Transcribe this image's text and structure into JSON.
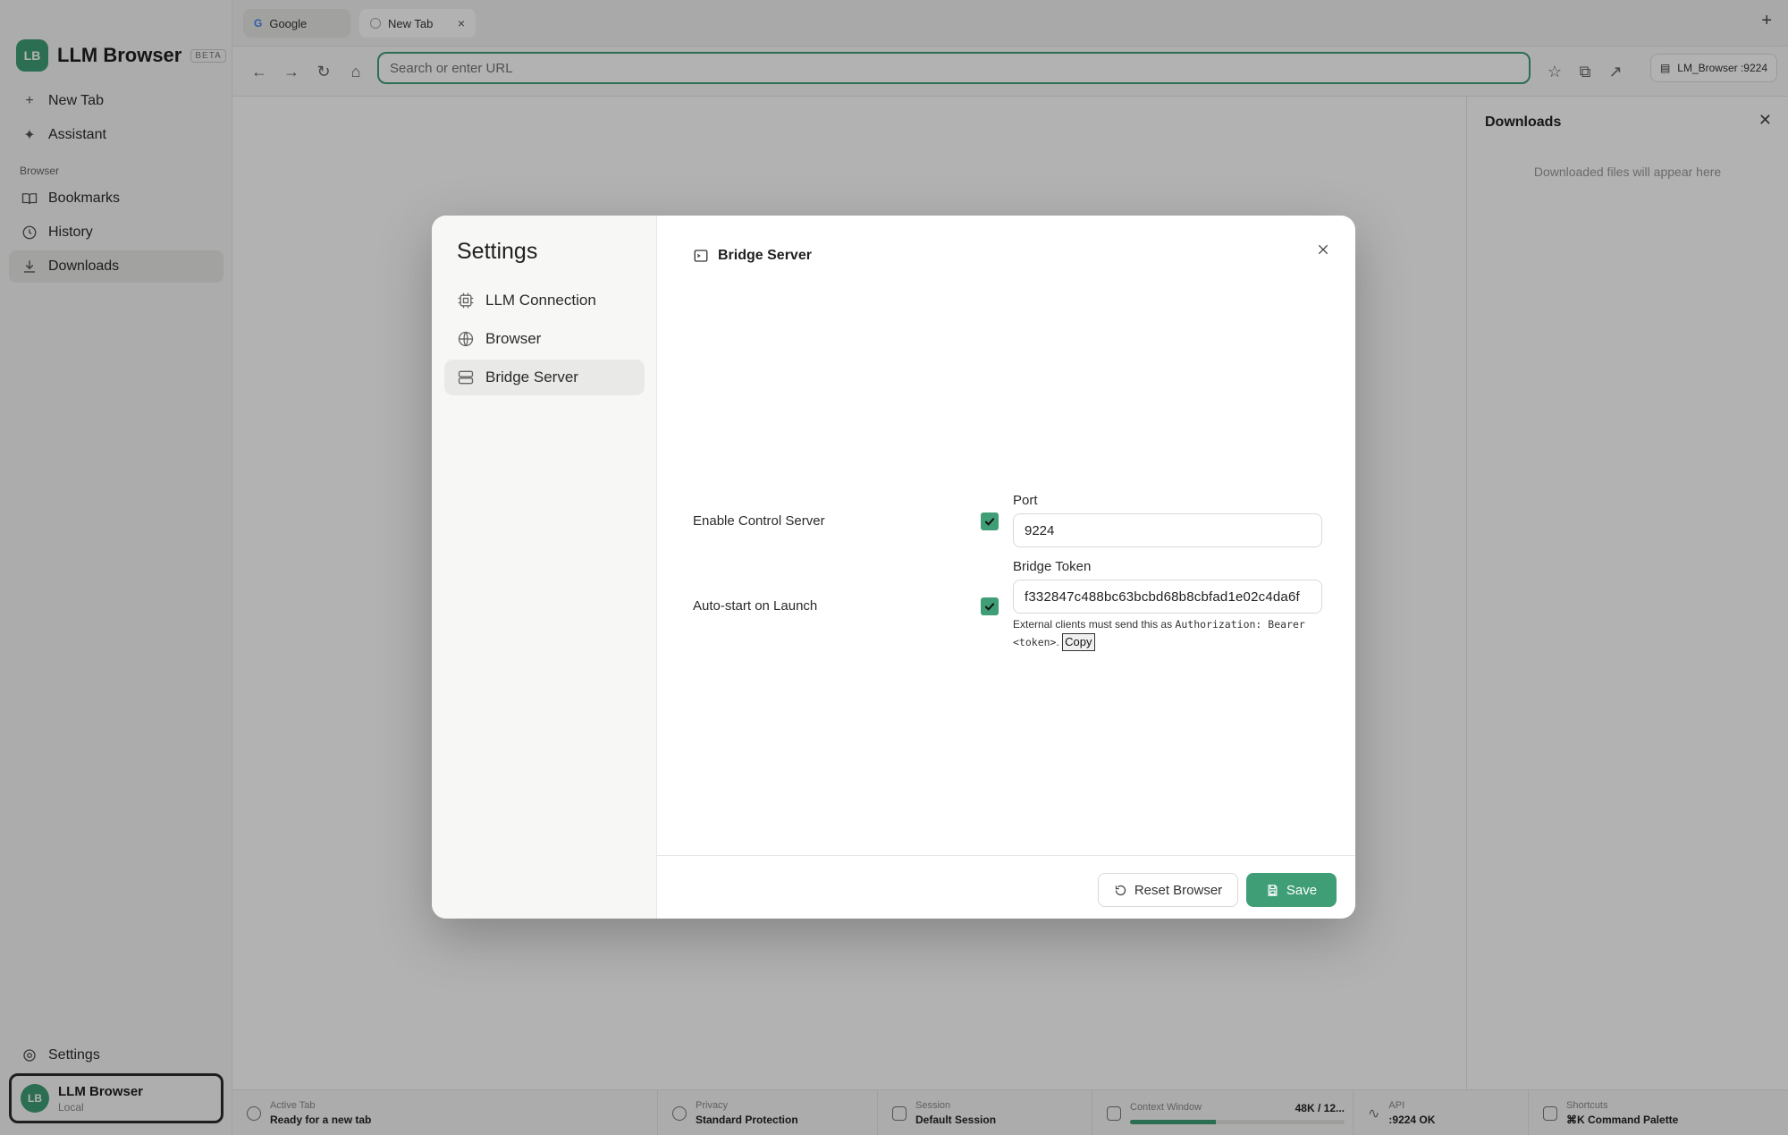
{
  "app": {
    "brand": {
      "logo": "LB",
      "name": "LLM Browser",
      "badge": "BETA"
    },
    "sidebar": {
      "items": [
        {
          "label": "New Tab",
          "icon": "plus-icon"
        },
        {
          "label": "Assistant",
          "icon": "sparkle-icon"
        }
      ],
      "section": "Browser",
      "browser_items": [
        {
          "label": "Bookmarks",
          "icon": "book-icon"
        },
        {
          "label": "History",
          "icon": "history-icon"
        },
        {
          "label": "Downloads",
          "icon": "download-icon",
          "active": true
        }
      ],
      "settings_label": "Settings",
      "user": {
        "avatar": "LB",
        "name": "LLM Browser",
        "sub": "Local"
      }
    },
    "tabs": [
      {
        "title": "Google"
      },
      {
        "title": "New Tab",
        "close": "×"
      }
    ],
    "url_placeholder": "Search or enter URL",
    "session_chip": "LM_Browser :9224",
    "downloads_panel": {
      "title": "Downloads",
      "empty": "Downloaded files will appear here"
    },
    "status": {
      "active_tab": {
        "label": "Active Tab",
        "value": "Ready for a new tab"
      },
      "privacy": {
        "label": "Privacy",
        "value": "Standard Protection"
      },
      "session": {
        "label": "Session",
        "value": "Default Session"
      },
      "context": {
        "label": "Context Window",
        "value": "48K / 12...",
        "fill_percent": 40
      },
      "api": {
        "label": "API",
        "value": ":9224 OK"
      },
      "shortcuts": {
        "label": "Shortcuts",
        "value": "⌘K Command Palette"
      }
    }
  },
  "settings": {
    "title": "Settings",
    "nav": [
      {
        "label": "LLM Connection",
        "icon": "chip-icon"
      },
      {
        "label": "Browser",
        "icon": "globe-icon"
      },
      {
        "label": "Bridge Server",
        "icon": "server-icon",
        "active": true
      }
    ],
    "section_title": "Bridge Server",
    "enable_label": "Enable Control Server",
    "enable_checked": true,
    "autostart_label": "Auto-start on Launch",
    "autostart_checked": true,
    "port_label": "Port",
    "port_value": "9224",
    "token_label": "Bridge Token",
    "token_value": "f332847c488bc63bcbd68b8cbfad1e02c4da6f",
    "help_prefix": "External clients must send this as ",
    "help_code": "Authorization: Bearer <token>",
    "help_suffix": ".",
    "copy_label": "Copy",
    "reset_label": "Reset Browser",
    "save_label": "Save",
    "accent": "#3f9e76"
  }
}
